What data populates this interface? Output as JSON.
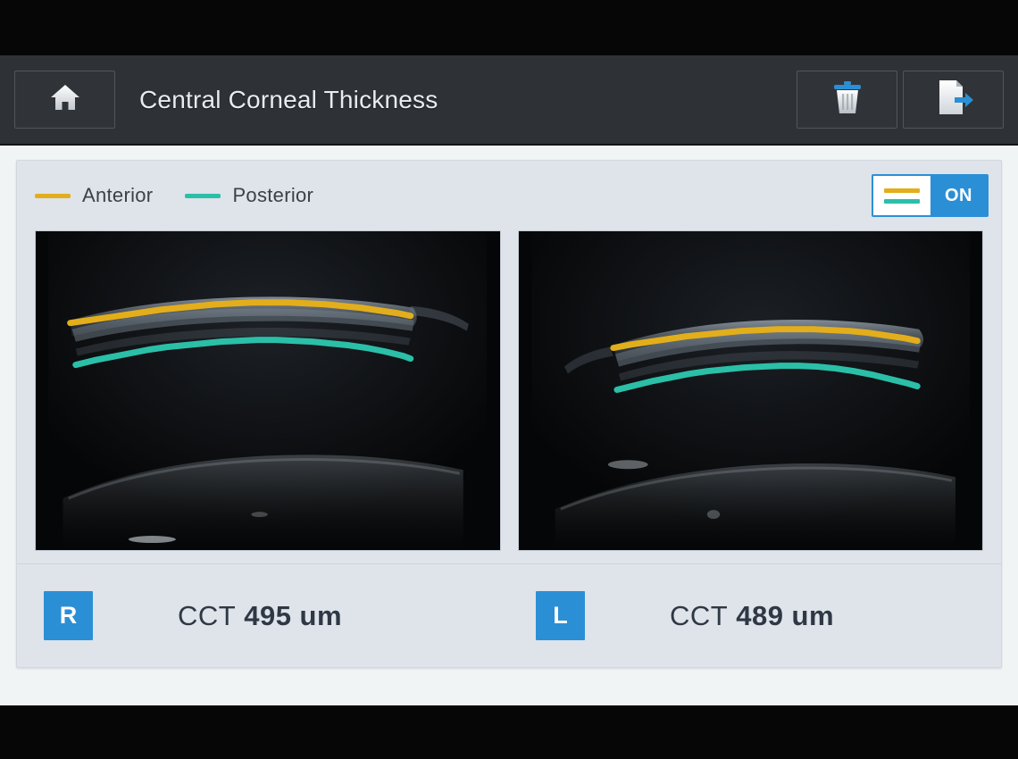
{
  "header": {
    "title": "Central Corneal Thickness",
    "home_icon": "home-icon",
    "delete_icon": "trash-icon",
    "export_icon": "export-document-icon"
  },
  "legend": {
    "items": [
      {
        "label": "Anterior",
        "color": "#e3ae1b",
        "icon": "line-swatch-icon"
      },
      {
        "label": "Posterior",
        "color": "#2bbfa8",
        "icon": "line-swatch-icon"
      }
    ]
  },
  "trace_toggle": {
    "state_label": "ON",
    "anterior_color": "#e3ae1b",
    "posterior_color": "#2bbfa8",
    "accent_color": "#2b8fd6"
  },
  "scans": [
    {
      "eye": "R",
      "panel_name": "oct-scan-right-eye"
    },
    {
      "eye": "L",
      "panel_name": "oct-scan-left-eye"
    }
  ],
  "measurements": [
    {
      "eye": "R",
      "label": "CCT",
      "value": "495 um"
    },
    {
      "eye": "L",
      "label": "CCT",
      "value": "489 um"
    }
  ],
  "colors": {
    "header_bg": "#2e3236",
    "page_bg": "#f0f4f5",
    "card_bg": "#dfe3ea",
    "accent": "#2b8fd6",
    "anterior": "#e3ae1b",
    "posterior": "#2bbfa8"
  }
}
